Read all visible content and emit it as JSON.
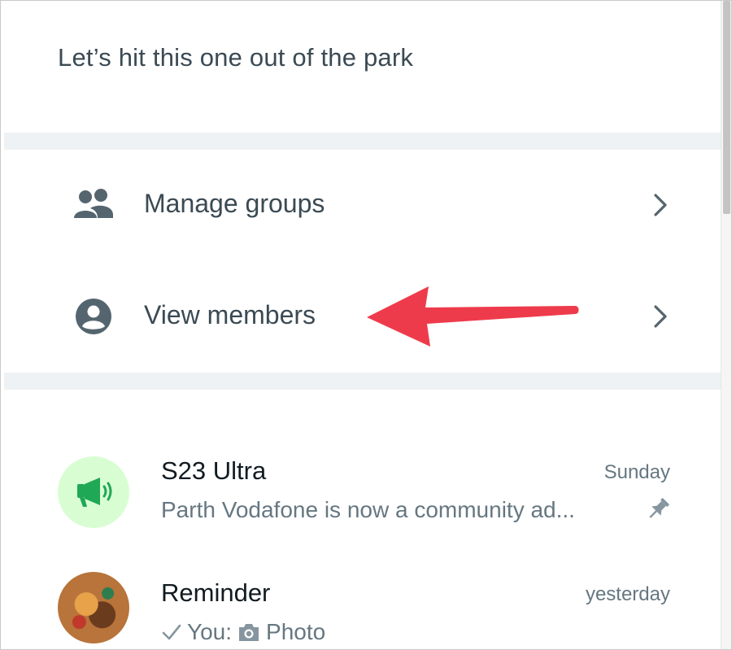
{
  "community": {
    "description": "Let’s hit this one out of the park"
  },
  "actions": [
    {
      "label": "Manage groups",
      "icon": "groups-icon"
    },
    {
      "label": "View members",
      "icon": "account-circle-icon"
    }
  ],
  "chats": [
    {
      "name": "S23 Ultra",
      "time": "Sunday",
      "preview": "Parth Vodafone is now a community ad...",
      "avatar": "megaphone-icon",
      "pinned": true
    },
    {
      "name": "Reminder",
      "time": "yesterday",
      "sender": "You:",
      "preview": "Photo",
      "status": "sent-check-icon",
      "media": "camera-icon"
    }
  ],
  "colors": {
    "annotation_arrow": "#ee3b4b",
    "community_avatar_bg": "#d9fdd3",
    "community_icon": "#1fa855",
    "text_primary": "#111b21",
    "text_secondary": "#667781"
  }
}
